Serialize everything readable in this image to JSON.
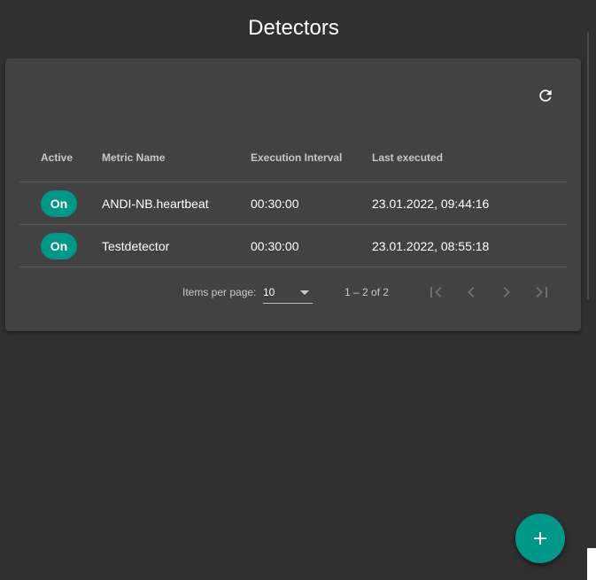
{
  "page": {
    "title": "Detectors"
  },
  "table": {
    "headers": {
      "active": "Active",
      "metric_name": "Metric Name",
      "execution_interval": "Execution Interval",
      "last_executed": "Last executed"
    },
    "rows": [
      {
        "active": "On",
        "metric_name": "ANDI-NB.heartbeat",
        "execution_interval": "00:30:00",
        "last_executed": "23.01.2022, 09:44:16"
      },
      {
        "active": "On",
        "metric_name": "Testdetector",
        "execution_interval": "00:30:00",
        "last_executed": "23.01.2022, 08:55:18"
      }
    ]
  },
  "paginator": {
    "items_per_page_label": "Items per page:",
    "items_per_page_value": "10",
    "range_label": "1 – 2 of 2"
  },
  "icons": {
    "refresh": "refresh-icon",
    "first_page": "first-page-icon",
    "previous_page": "chevron-left-icon",
    "next_page": "chevron-right-icon",
    "last_page": "last-page-icon",
    "add": "plus-icon",
    "dropdown": "caret-down-icon"
  },
  "colors": {
    "background": "#303030",
    "card": "#424242",
    "accent": "#009688",
    "divider": "#5a5a5a"
  }
}
